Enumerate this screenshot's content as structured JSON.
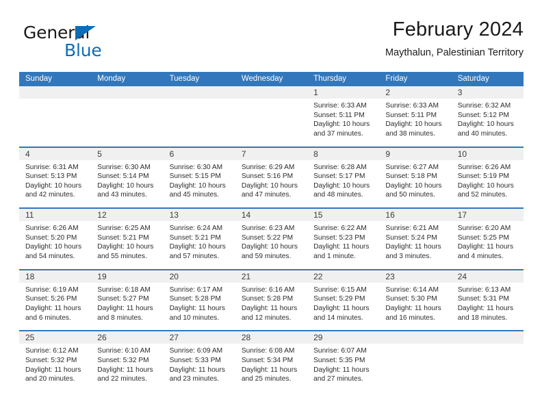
{
  "brand": {
    "word1": "General",
    "word2": "Blue",
    "triangle_color": "#0f6cb5"
  },
  "header": {
    "title": "February 2024",
    "location": "Maythalun, Palestinian Territory"
  },
  "theme": {
    "header_blue": "#3277bb",
    "daynum_band": "#f0f0f0",
    "text": "#2b2b2b"
  },
  "weekdays": [
    "Sunday",
    "Monday",
    "Tuesday",
    "Wednesday",
    "Thursday",
    "Friday",
    "Saturday"
  ],
  "weeks": [
    [
      {
        "day": "",
        "lines": []
      },
      {
        "day": "",
        "lines": []
      },
      {
        "day": "",
        "lines": []
      },
      {
        "day": "",
        "lines": []
      },
      {
        "day": "1",
        "lines": [
          "Sunrise: 6:33 AM",
          "Sunset: 5:11 PM",
          "Daylight: 10 hours",
          "and 37 minutes."
        ]
      },
      {
        "day": "2",
        "lines": [
          "Sunrise: 6:33 AM",
          "Sunset: 5:11 PM",
          "Daylight: 10 hours",
          "and 38 minutes."
        ]
      },
      {
        "day": "3",
        "lines": [
          "Sunrise: 6:32 AM",
          "Sunset: 5:12 PM",
          "Daylight: 10 hours",
          "and 40 minutes."
        ]
      }
    ],
    [
      {
        "day": "4",
        "lines": [
          "Sunrise: 6:31 AM",
          "Sunset: 5:13 PM",
          "Daylight: 10 hours",
          "and 42 minutes."
        ]
      },
      {
        "day": "5",
        "lines": [
          "Sunrise: 6:30 AM",
          "Sunset: 5:14 PM",
          "Daylight: 10 hours",
          "and 43 minutes."
        ]
      },
      {
        "day": "6",
        "lines": [
          "Sunrise: 6:30 AM",
          "Sunset: 5:15 PM",
          "Daylight: 10 hours",
          "and 45 minutes."
        ]
      },
      {
        "day": "7",
        "lines": [
          "Sunrise: 6:29 AM",
          "Sunset: 5:16 PM",
          "Daylight: 10 hours",
          "and 47 minutes."
        ]
      },
      {
        "day": "8",
        "lines": [
          "Sunrise: 6:28 AM",
          "Sunset: 5:17 PM",
          "Daylight: 10 hours",
          "and 48 minutes."
        ]
      },
      {
        "day": "9",
        "lines": [
          "Sunrise: 6:27 AM",
          "Sunset: 5:18 PM",
          "Daylight: 10 hours",
          "and 50 minutes."
        ]
      },
      {
        "day": "10",
        "lines": [
          "Sunrise: 6:26 AM",
          "Sunset: 5:19 PM",
          "Daylight: 10 hours",
          "and 52 minutes."
        ]
      }
    ],
    [
      {
        "day": "11",
        "lines": [
          "Sunrise: 6:26 AM",
          "Sunset: 5:20 PM",
          "Daylight: 10 hours",
          "and 54 minutes."
        ]
      },
      {
        "day": "12",
        "lines": [
          "Sunrise: 6:25 AM",
          "Sunset: 5:21 PM",
          "Daylight: 10 hours",
          "and 55 minutes."
        ]
      },
      {
        "day": "13",
        "lines": [
          "Sunrise: 6:24 AM",
          "Sunset: 5:21 PM",
          "Daylight: 10 hours",
          "and 57 minutes."
        ]
      },
      {
        "day": "14",
        "lines": [
          "Sunrise: 6:23 AM",
          "Sunset: 5:22 PM",
          "Daylight: 10 hours",
          "and 59 minutes."
        ]
      },
      {
        "day": "15",
        "lines": [
          "Sunrise: 6:22 AM",
          "Sunset: 5:23 PM",
          "Daylight: 11 hours",
          "and 1 minute."
        ]
      },
      {
        "day": "16",
        "lines": [
          "Sunrise: 6:21 AM",
          "Sunset: 5:24 PM",
          "Daylight: 11 hours",
          "and 3 minutes."
        ]
      },
      {
        "day": "17",
        "lines": [
          "Sunrise: 6:20 AM",
          "Sunset: 5:25 PM",
          "Daylight: 11 hours",
          "and 4 minutes."
        ]
      }
    ],
    [
      {
        "day": "18",
        "lines": [
          "Sunrise: 6:19 AM",
          "Sunset: 5:26 PM",
          "Daylight: 11 hours",
          "and 6 minutes."
        ]
      },
      {
        "day": "19",
        "lines": [
          "Sunrise: 6:18 AM",
          "Sunset: 5:27 PM",
          "Daylight: 11 hours",
          "and 8 minutes."
        ]
      },
      {
        "day": "20",
        "lines": [
          "Sunrise: 6:17 AM",
          "Sunset: 5:28 PM",
          "Daylight: 11 hours",
          "and 10 minutes."
        ]
      },
      {
        "day": "21",
        "lines": [
          "Sunrise: 6:16 AM",
          "Sunset: 5:28 PM",
          "Daylight: 11 hours",
          "and 12 minutes."
        ]
      },
      {
        "day": "22",
        "lines": [
          "Sunrise: 6:15 AM",
          "Sunset: 5:29 PM",
          "Daylight: 11 hours",
          "and 14 minutes."
        ]
      },
      {
        "day": "23",
        "lines": [
          "Sunrise: 6:14 AM",
          "Sunset: 5:30 PM",
          "Daylight: 11 hours",
          "and 16 minutes."
        ]
      },
      {
        "day": "24",
        "lines": [
          "Sunrise: 6:13 AM",
          "Sunset: 5:31 PM",
          "Daylight: 11 hours",
          "and 18 minutes."
        ]
      }
    ],
    [
      {
        "day": "25",
        "lines": [
          "Sunrise: 6:12 AM",
          "Sunset: 5:32 PM",
          "Daylight: 11 hours",
          "and 20 minutes."
        ]
      },
      {
        "day": "26",
        "lines": [
          "Sunrise: 6:10 AM",
          "Sunset: 5:32 PM",
          "Daylight: 11 hours",
          "and 22 minutes."
        ]
      },
      {
        "day": "27",
        "lines": [
          "Sunrise: 6:09 AM",
          "Sunset: 5:33 PM",
          "Daylight: 11 hours",
          "and 23 minutes."
        ]
      },
      {
        "day": "28",
        "lines": [
          "Sunrise: 6:08 AM",
          "Sunset: 5:34 PM",
          "Daylight: 11 hours",
          "and 25 minutes."
        ]
      },
      {
        "day": "29",
        "lines": [
          "Sunrise: 6:07 AM",
          "Sunset: 5:35 PM",
          "Daylight: 11 hours",
          "and 27 minutes."
        ]
      },
      {
        "day": "",
        "lines": []
      },
      {
        "day": "",
        "lines": []
      }
    ]
  ]
}
